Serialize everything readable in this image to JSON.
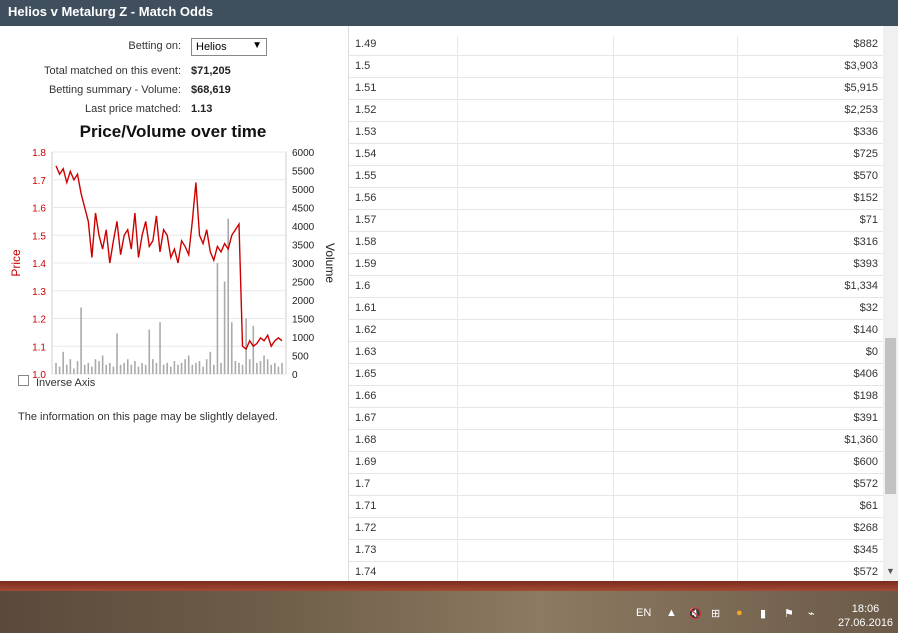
{
  "window": {
    "title": "Helios v Metalurg Z - Match Odds"
  },
  "form": {
    "betting_on_label": "Betting on:",
    "betting_on_value": "Helios",
    "total_matched_label": "Total matched on this event:",
    "total_matched_value": "$71,205",
    "summary_label": "Betting summary - Volume:",
    "summary_value": "$68,619",
    "last_price_label": "Last price matched:",
    "last_price_value": "1.13",
    "inverse_axis_label": "Inverse Axis",
    "info_text": "The information on this page may be slightly delayed."
  },
  "chart_data": {
    "type": "line",
    "title": "Price/Volume over time",
    "ylabel": "Price",
    "y2label": "Volume",
    "ylim": [
      1.0,
      1.8
    ],
    "y2lim": [
      0,
      6000
    ],
    "yticks": [
      "1.8",
      "1.7",
      "1.6",
      "1.5",
      "1.4",
      "1.3",
      "1.2",
      "1.1",
      "1.0"
    ],
    "y2ticks": [
      "6000",
      "5500",
      "5000",
      "4500",
      "4000",
      "3500",
      "3000",
      "2500",
      "2000",
      "1500",
      "1000",
      "500",
      "0"
    ],
    "price_color": "#cc0000",
    "volume_color": "#aaaaaa",
    "price_series": [
      1.75,
      1.72,
      1.74,
      1.69,
      1.73,
      1.7,
      1.72,
      1.65,
      1.6,
      1.55,
      1.42,
      1.58,
      1.5,
      1.45,
      1.52,
      1.4,
      1.48,
      1.55,
      1.43,
      1.5,
      1.52,
      1.45,
      1.58,
      1.42,
      1.5,
      1.55,
      1.46,
      1.48,
      1.57,
      1.44,
      1.52,
      1.5,
      1.42,
      1.45,
      1.4,
      1.48,
      1.46,
      1.43,
      1.55,
      1.69,
      1.5,
      1.47,
      1.52,
      1.44,
      1.41,
      1.46,
      1.44,
      1.47,
      1.45,
      1.5,
      1.52,
      1.54,
      1.1,
      1.09,
      1.12,
      1.1,
      1.11,
      1.13,
      1.12,
      1.14,
      1.1,
      1.12,
      1.13,
      1.12
    ],
    "volume_series": [
      300,
      200,
      600,
      250,
      400,
      150,
      350,
      1800,
      250,
      300,
      200,
      400,
      350,
      500,
      250,
      300,
      200,
      1100,
      250,
      300,
      400,
      250,
      350,
      200,
      300,
      250,
      1200,
      400,
      300,
      1400,
      250,
      300,
      200,
      350,
      250,
      300,
      400,
      500,
      250,
      300,
      350,
      200,
      400,
      600,
      250,
      3000,
      300,
      2500,
      4200,
      1400,
      350,
      300,
      250,
      1500,
      400,
      1300,
      300,
      350,
      500,
      400,
      250,
      300,
      200,
      300
    ]
  },
  "ladder": {
    "rows": [
      {
        "price": "1.49",
        "volume": "$882"
      },
      {
        "price": "1.5",
        "volume": "$3,903"
      },
      {
        "price": "1.51",
        "volume": "$5,915"
      },
      {
        "price": "1.52",
        "volume": "$2,253"
      },
      {
        "price": "1.53",
        "volume": "$336"
      },
      {
        "price": "1.54",
        "volume": "$725"
      },
      {
        "price": "1.55",
        "volume": "$570"
      },
      {
        "price": "1.56",
        "volume": "$152"
      },
      {
        "price": "1.57",
        "volume": "$71"
      },
      {
        "price": "1.58",
        "volume": "$316"
      },
      {
        "price": "1.59",
        "volume": "$393"
      },
      {
        "price": "1.6",
        "volume": "$1,334"
      },
      {
        "price": "1.61",
        "volume": "$32"
      },
      {
        "price": "1.62",
        "volume": "$140"
      },
      {
        "price": "1.63",
        "volume": "$0"
      },
      {
        "price": "1.65",
        "volume": "$406"
      },
      {
        "price": "1.66",
        "volume": "$198"
      },
      {
        "price": "1.67",
        "volume": "$391"
      },
      {
        "price": "1.68",
        "volume": "$1,360"
      },
      {
        "price": "1.69",
        "volume": "$600"
      },
      {
        "price": "1.7",
        "volume": "$572"
      },
      {
        "price": "1.71",
        "volume": "$61"
      },
      {
        "price": "1.72",
        "volume": "$268"
      },
      {
        "price": "1.73",
        "volume": "$345"
      },
      {
        "price": "1.74",
        "volume": "$572"
      }
    ]
  },
  "taskbar": {
    "language": "EN",
    "time": "18:06",
    "date": "27.06.2016"
  }
}
